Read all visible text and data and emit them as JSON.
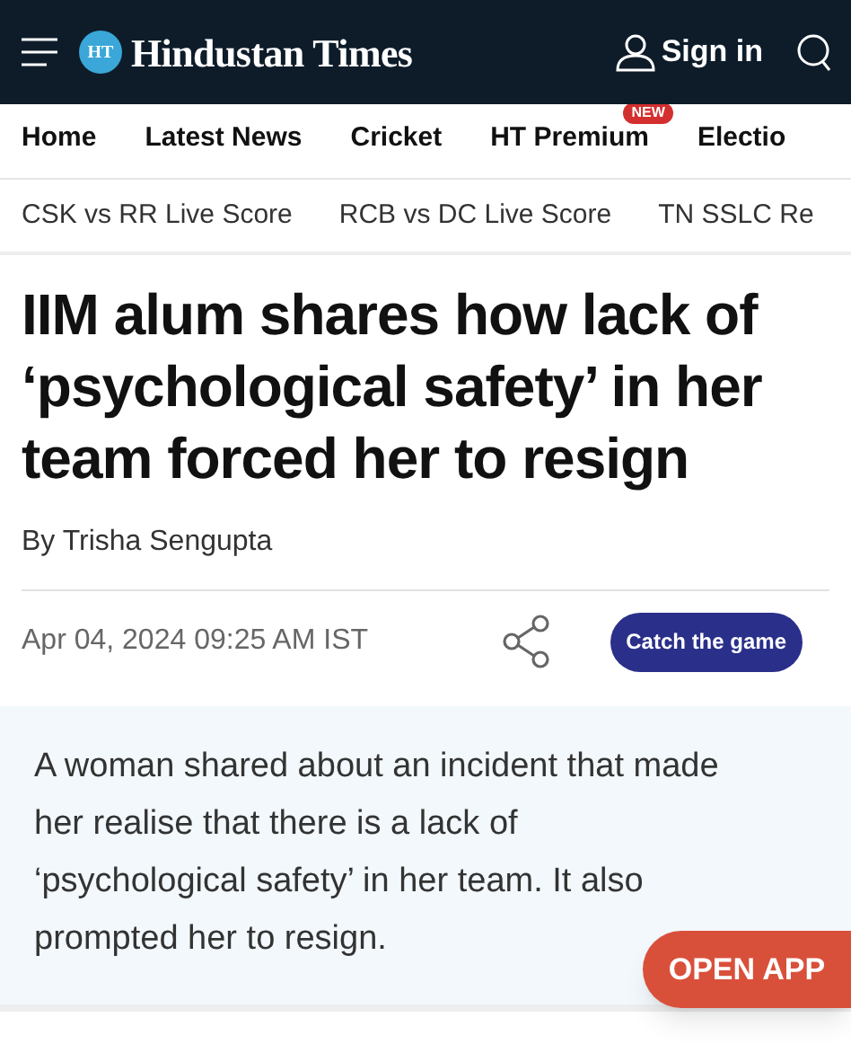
{
  "header": {
    "logo_mark": "HT",
    "logo_text": "Hindustan Times",
    "sign_in": "Sign in"
  },
  "nav": [
    {
      "label": "Home"
    },
    {
      "label": "Latest News"
    },
    {
      "label": "Cricket"
    },
    {
      "label": "HT Premium",
      "badge": "NEW"
    },
    {
      "label": "Electio"
    }
  ],
  "trending": [
    {
      "label": "CSK vs RR Live Score"
    },
    {
      "label": "RCB vs DC Live Score"
    },
    {
      "label": "TN SSLC Re"
    }
  ],
  "article": {
    "headline": "IIM alum shares how lack of ‘psychological safety’ in her team forced her to resign",
    "byline": "By Trisha Sengupta",
    "date": "Apr 04, 2024 09:25 AM IST",
    "cta": "Catch the game",
    "summary": "A woman shared about an incident that made her realise that there is a lack of ‘psychological safety’ in her team. It also prompted her to resign."
  },
  "open_app": "OPEN APP"
}
